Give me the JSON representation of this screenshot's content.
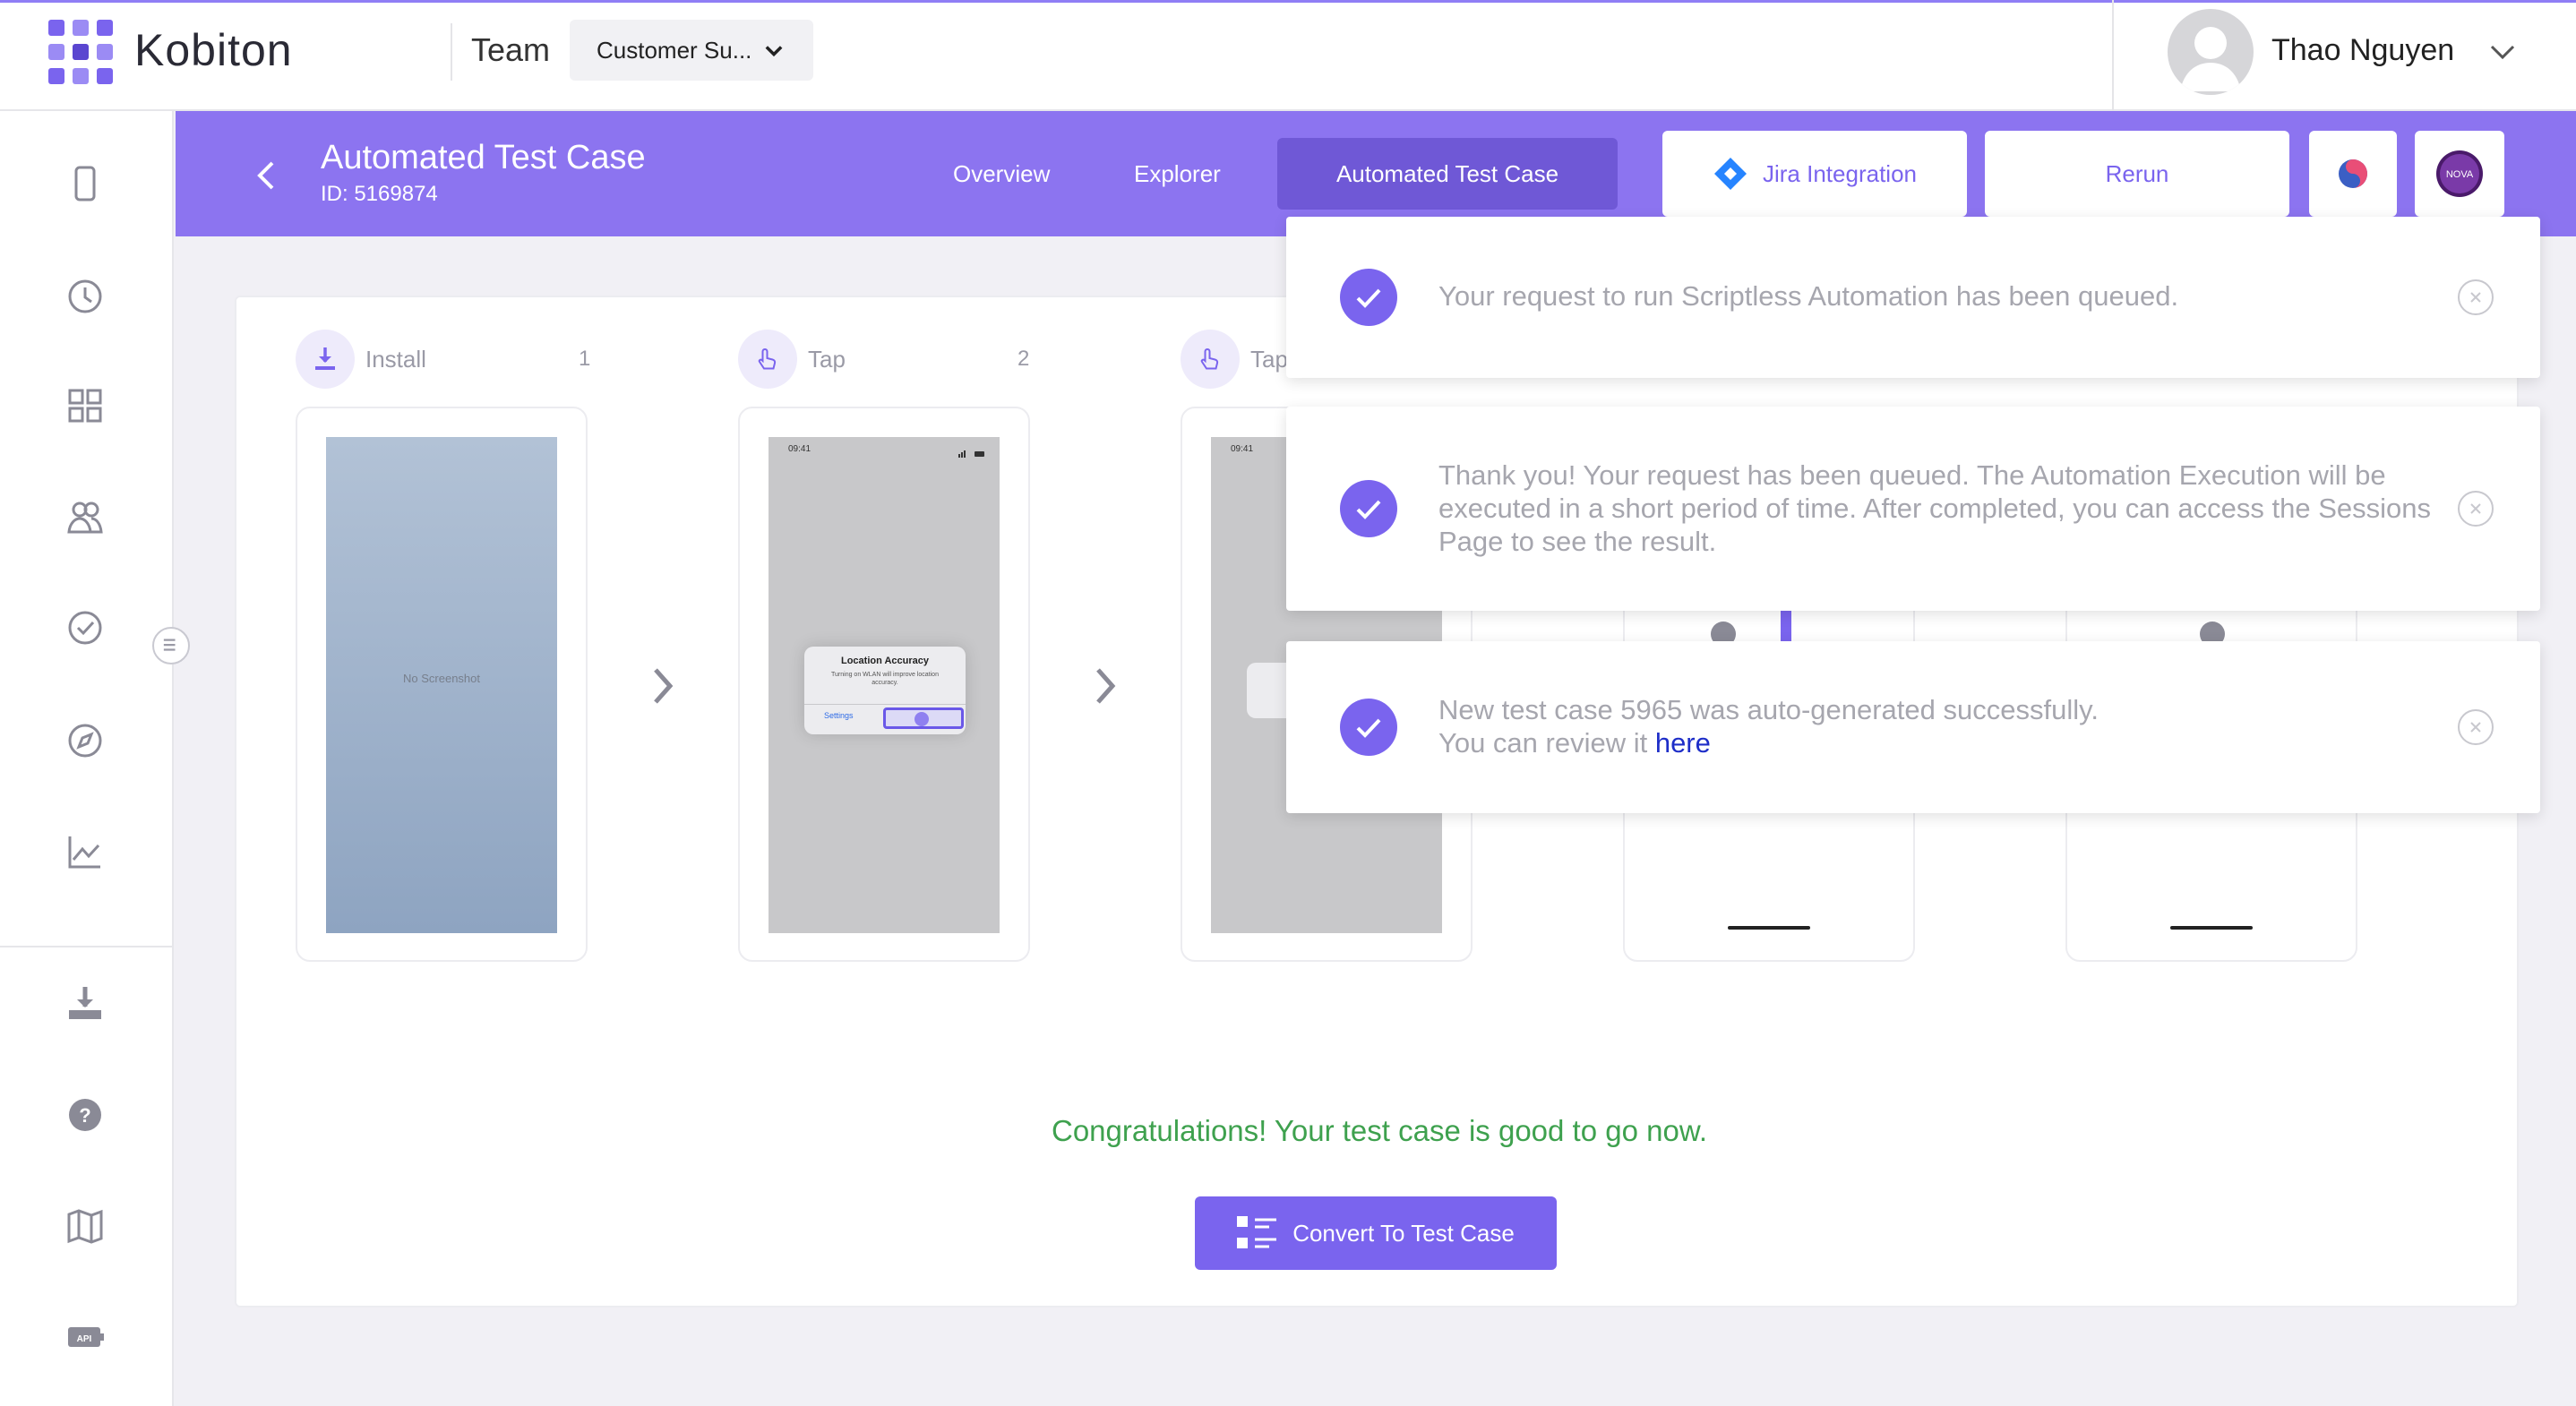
{
  "topbar": {
    "brand": "Kobiton",
    "team_label": "Team",
    "team_select_value": "Customer Su...",
    "user_name": "Thao Nguyen"
  },
  "sidebar": {
    "items": [
      "device-icon",
      "clock-icon",
      "grid-icon",
      "users-icon",
      "check-circle-icon",
      "compass-icon",
      "chart-icon",
      "download-icon",
      "help-icon",
      "map-icon",
      "api-icon"
    ]
  },
  "header": {
    "title": "Automated Test Case",
    "id_text": "ID: 5169874",
    "nav": [
      "Overview",
      "Explorer",
      "Automated Test Case"
    ],
    "jira_button": "Jira Integration",
    "rerun_button": "Rerun"
  },
  "steps": [
    {
      "action": "Install",
      "number": "1",
      "screen_text": "No Screenshot"
    },
    {
      "action": "Tap",
      "number": "2",
      "dialog_title": "Location Accuracy",
      "dialog_text": "Turning on WLAN will improve location accuracy.",
      "dialog_button": "Settings",
      "status_time": "09:41"
    },
    {
      "action": "Tap",
      "status_time": "09:41"
    }
  ],
  "main": {
    "congrats": "Congratulations! Your test case is good to go now.",
    "convert_button": "Convert To Test Case"
  },
  "notifications": [
    {
      "text": "Your request to run Scriptless Automation has been queued."
    },
    {
      "text": "Thank you! Your request has been queued. The Automation Execution will be executed in a short period of time. After completed, you can access the Sessions Page to see the result."
    },
    {
      "line1": "New test case 5965 was auto-generated successfully.",
      "line2_prefix": "You can review it ",
      "link": "here"
    }
  ],
  "colors": {
    "accent": "#8c74f0",
    "accent_dark": "#6f58d6",
    "button": "#7a64ee",
    "success": "#3ea14e",
    "link": "#1e2ec8"
  }
}
